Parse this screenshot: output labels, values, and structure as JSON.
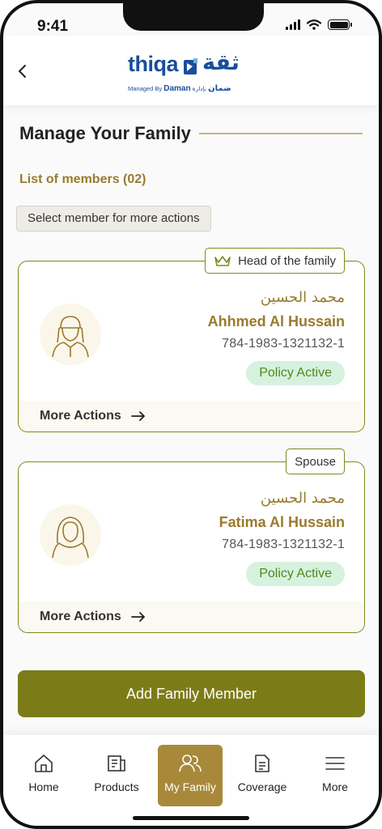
{
  "status_bar": {
    "time": "9:41"
  },
  "header": {
    "logo_en": "thiqa",
    "logo_ar": "ثقة",
    "logo_sub_managed": "Managed By",
    "logo_sub_daman": "Daman",
    "logo_sub_daman_ar": "ضمان",
    "logo_sub_by_ar": "بإدارة"
  },
  "page": {
    "title": "Manage Your Family",
    "members_count": "List of members (02)",
    "hint": "Select member for more actions"
  },
  "members": [
    {
      "tag": "Head of the family",
      "name_ar": "محمد الحسين",
      "name_en": "Ahhmed Al Hussain",
      "emirates_id": "784-1983-1321132-1",
      "status": "Policy Active",
      "more_actions": "More Actions"
    },
    {
      "tag": "Spouse",
      "name_ar": "محمد الحسين",
      "name_en": "Fatima Al Hussain",
      "emirates_id": "784-1983-1321132-1",
      "status": "Policy Active",
      "more_actions": "More Actions"
    }
  ],
  "add_button": "Add Family Member",
  "nav": [
    {
      "label": "Home",
      "icon": "home-icon"
    },
    {
      "label": "Products",
      "icon": "products-icon"
    },
    {
      "label": "My Family",
      "icon": "family-icon",
      "active": true
    },
    {
      "label": "Coverage",
      "icon": "document-icon"
    },
    {
      "label": "More",
      "icon": "menu-icon"
    }
  ],
  "colors": {
    "brand_gold": "#9a7a2e",
    "brand_olive": "#7b7c18",
    "active_nav": "#a8893a",
    "status_green_bg": "#d6f2df",
    "status_green_text": "#4f8a1b",
    "logo_blue": "#1a4e9c"
  }
}
